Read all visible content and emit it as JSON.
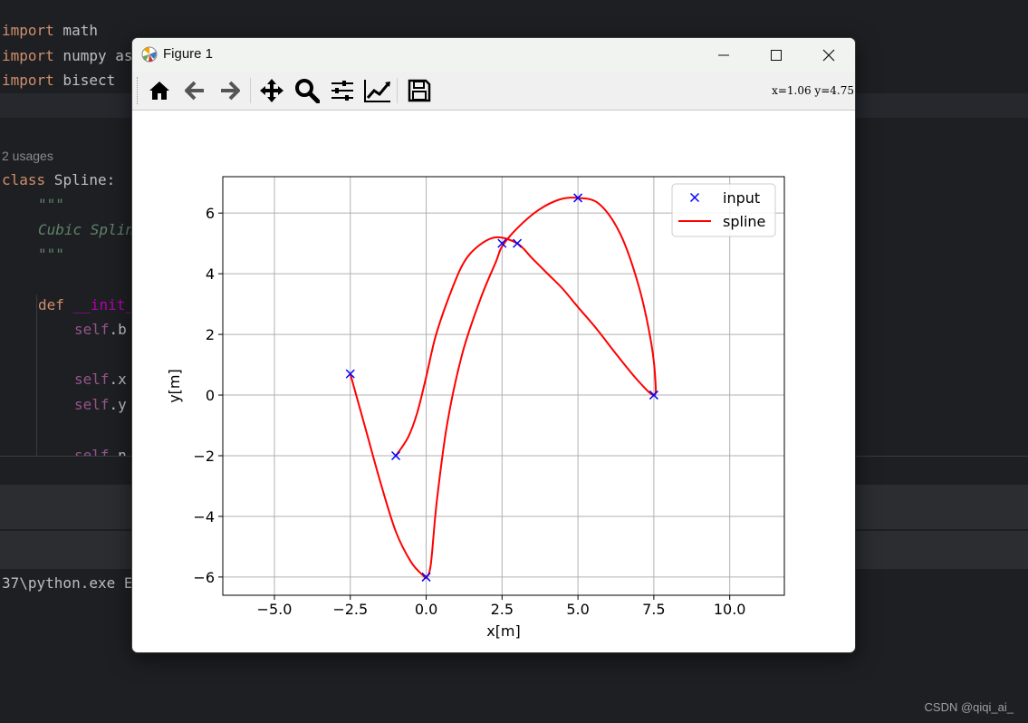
{
  "editor": {
    "imports": [
      {
        "kw": "import",
        "rest": " math"
      },
      {
        "kw": "import",
        "rest": " numpy as"
      },
      {
        "kw": "import",
        "rest": " bisect"
      }
    ],
    "usages": "2 usages",
    "class_kw": "class",
    "class_rest": " Spline:",
    "doc_open": "\"\"\"",
    "doc_text": "Cubic Splin",
    "doc_close": "\"\"\"",
    "def_kw": "def",
    "def_name": "__init_",
    "self_b_self": "self",
    "self_b_rest": ".b",
    "self_x_self": "self",
    "self_x_rest": ".x",
    "self_y_self": "self",
    "self_y_rest": ".y",
    "self_n_self": "self",
    "self_n_rest": ".n",
    "terminal_line": "37\\python.exe E"
  },
  "watermark": "CSDN @qiqi_ai_",
  "window": {
    "title": "Figure 1",
    "coords": "x=1.06 y=4.75"
  },
  "colors": {
    "input_marker": "#0000ff",
    "spline": "#ff0000",
    "grid": "#b0b0b0"
  },
  "chart_data": {
    "type": "line",
    "xlabel": "x[m]",
    "ylabel": "y[m]",
    "xlim": [
      -6.7,
      11.8
    ],
    "ylim": [
      -6.6,
      7.2
    ],
    "xticks": [
      -5.0,
      -2.5,
      0.0,
      2.5,
      5.0,
      7.5,
      10.0
    ],
    "xtick_labels": [
      "−5.0",
      "−2.5",
      "0.0",
      "2.5",
      "5.0",
      "7.5",
      "10.0"
    ],
    "yticks": [
      -6,
      -4,
      -2,
      0,
      2,
      4,
      6
    ],
    "ytick_labels": [
      "−6",
      "−4",
      "−2",
      "0",
      "2",
      "4",
      "6"
    ],
    "grid": true,
    "legend_position": "top-right",
    "series": [
      {
        "name": "input",
        "style": "x-markers",
        "x": [
          -2.5,
          0.0,
          2.5,
          5.0,
          7.5,
          3.0,
          -1.0
        ],
        "y": [
          0.7,
          -6.0,
          5.0,
          6.5,
          0.0,
          5.0,
          -2.0
        ]
      },
      {
        "name": "spline",
        "style": "line",
        "x": [
          -2.5,
          -2.0,
          -1.5,
          -1.0,
          -0.5,
          -0.1,
          0.0,
          0.15,
          0.35,
          0.7,
          1.2,
          1.8,
          2.3,
          2.5,
          3.0,
          3.7,
          4.4,
          5.0,
          5.7,
          6.4,
          7.0,
          7.4,
          7.55,
          7.5,
          7.0,
          6.3,
          5.6,
          5.0,
          4.5,
          4.0,
          3.5,
          3.0,
          2.3,
          1.7,
          1.2,
          0.7,
          0.3,
          0.0,
          -0.3,
          -0.6,
          -1.0
        ],
        "y": [
          0.7,
          -1.1,
          -2.9,
          -4.5,
          -5.5,
          -5.95,
          -6.0,
          -5.6,
          -3.5,
          -0.9,
          1.4,
          3.2,
          4.4,
          4.9,
          5.5,
          6.1,
          6.45,
          6.5,
          6.3,
          5.3,
          3.6,
          1.8,
          0.5,
          0.0,
          0.45,
          1.3,
          2.2,
          2.9,
          3.5,
          4.0,
          4.5,
          5.0,
          5.2,
          4.9,
          4.3,
          3.1,
          1.9,
          0.6,
          -0.6,
          -1.4,
          -2.0
        ]
      }
    ]
  }
}
